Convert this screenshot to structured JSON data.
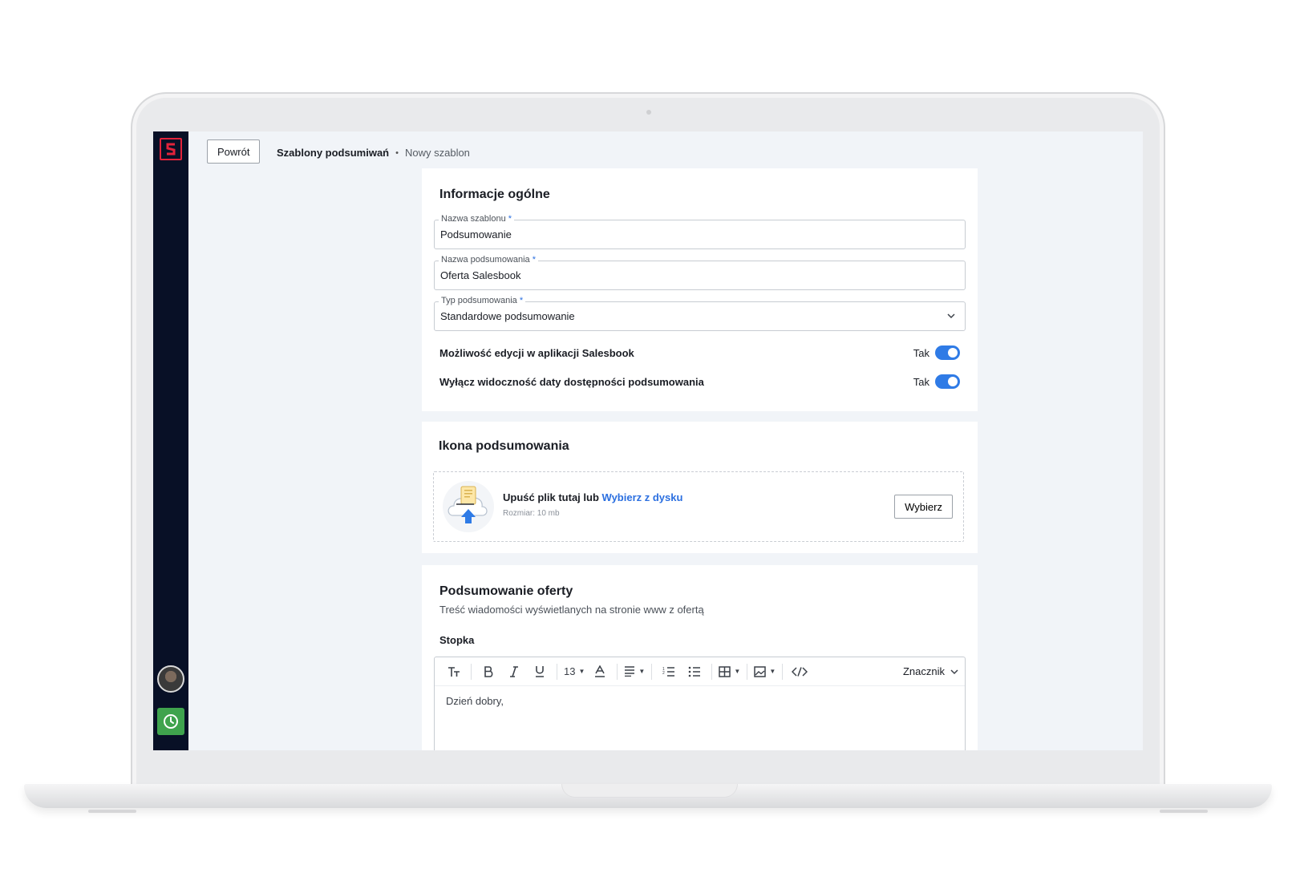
{
  "topbar": {
    "back_label": "Powrót",
    "breadcrumb_parent": "Szablony podsumiwań",
    "breadcrumb_separator": "•",
    "breadcrumb_current": "Nowy szablon"
  },
  "general": {
    "title": "Informacje ogólne",
    "fields": [
      {
        "label": "Nazwa szablonu",
        "required": "*",
        "value": "Podsumowanie"
      },
      {
        "label": "Nazwa podsumowania",
        "required": "*",
        "value": "Oferta Salesbook"
      },
      {
        "label": "Typ podsumowania",
        "required": "*",
        "value": "Standardowe podsumowanie"
      }
    ],
    "toggles": [
      {
        "label": "Możliwość edycji w aplikacji Salesbook",
        "state_label": "Tak",
        "on": true
      },
      {
        "label": "Wyłącz widoczność daty dostępności podsumowania",
        "state_label": "Tak",
        "on": true
      }
    ]
  },
  "icon_section": {
    "title": "Ikona podsumowania",
    "drop_text": "Upuść plik tutaj lub",
    "drop_link": "Wybierz z dysku",
    "size_note": "Rozmiar: 10 mb",
    "choose_label": "Wybierz"
  },
  "summary": {
    "title": "Podsumowanie oferty",
    "subtitle": "Treść wiadomości wyświetlanych na stronie www z ofertą",
    "footer_label": "Stopka",
    "toolbar": {
      "font_size": "13",
      "tag_menu_label": "Znacznik"
    },
    "body_line1": "Dzień dobry,"
  },
  "colors": {
    "sidebar_bg": "#081026",
    "brand_red": "#e2233b",
    "accent_blue": "#2f7be6",
    "timer_green": "#3fa34d",
    "screen_bg": "#f1f4f8"
  },
  "icons": [
    "logo-icon",
    "avatar",
    "clock-icon",
    "chevron-down-icon",
    "cloud-upload-icon",
    "text-style-icon",
    "bold-icon",
    "italic-icon",
    "underline-icon",
    "text-color-icon",
    "align-icon",
    "ordered-list-icon",
    "bullet-list-icon",
    "table-icon",
    "image-icon",
    "code-icon"
  ]
}
